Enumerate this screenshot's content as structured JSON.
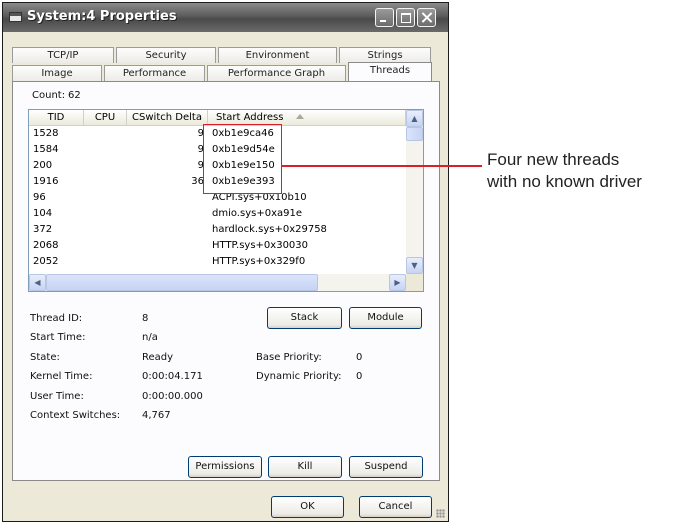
{
  "window": {
    "title": "System:4 Properties"
  },
  "tabs": {
    "row_top": [
      "TCP/IP",
      "Security",
      "Environment",
      "Strings"
    ],
    "row_bottom": [
      "Image",
      "Performance",
      "Performance Graph",
      "Threads"
    ],
    "active": "Threads"
  },
  "count": {
    "label": "Count:",
    "value": "62"
  },
  "thread_list": {
    "columns": [
      "TID",
      "CPU",
      "CSwitch Delta",
      "Start Address"
    ],
    "sorted_column": "Start Address",
    "rows": [
      {
        "tid": "1528",
        "cpu": "",
        "cswitch": "9",
        "start": "0xb1e9ca46"
      },
      {
        "tid": "1584",
        "cpu": "",
        "cswitch": "9",
        "start": "0xb1e9d54e"
      },
      {
        "tid": "200",
        "cpu": "",
        "cswitch": "9",
        "start": "0xb1e9e150"
      },
      {
        "tid": "1916",
        "cpu": "",
        "cswitch": "36",
        "start": "0xb1e9e393"
      },
      {
        "tid": "96",
        "cpu": "",
        "cswitch": "",
        "start": "ACPI.sys+0x10b10"
      },
      {
        "tid": "104",
        "cpu": "",
        "cswitch": "",
        "start": "dmio.sys+0xa91e"
      },
      {
        "tid": "372",
        "cpu": "",
        "cswitch": "",
        "start": "hardlock.sys+0x29758"
      },
      {
        "tid": "2068",
        "cpu": "",
        "cswitch": "",
        "start": "HTTP.sys+0x30030"
      },
      {
        "tid": "2052",
        "cpu": "",
        "cswitch": "",
        "start": "HTTP.sys+0x329f0"
      }
    ]
  },
  "details": {
    "thread_id": {
      "label": "Thread ID:",
      "value": "8"
    },
    "start_time": {
      "label": "Start Time:",
      "value": "n/a"
    },
    "state": {
      "label": "State:",
      "value": "Ready"
    },
    "kernel_time": {
      "label": "Kernel Time:",
      "value": "0:00:04.171"
    },
    "user_time": {
      "label": "User Time:",
      "value": "0:00:00.000"
    },
    "context_switches": {
      "label": "Context Switches:",
      "value": "4,767"
    },
    "base_priority": {
      "label": "Base Priority:",
      "value": "0"
    },
    "dynamic_priority": {
      "label": "Dynamic Priority:",
      "value": "0"
    }
  },
  "buttons": {
    "stack": "Stack",
    "module": "Module",
    "permissions": "Permissions",
    "kill": "Kill",
    "suspend": "Suspend",
    "ok": "OK",
    "cancel": "Cancel"
  },
  "annotation": {
    "line1": "Four new threads",
    "line2": "with no known driver",
    "color": "#d8202a"
  }
}
